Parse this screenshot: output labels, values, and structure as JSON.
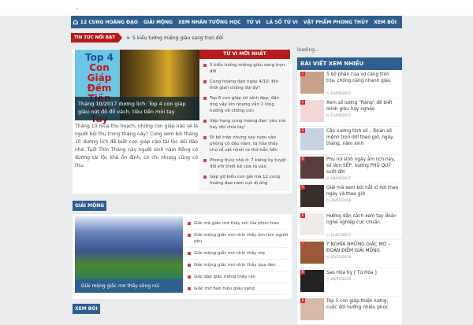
{
  "nav": {
    "items": [
      "12 CUNG HOÀNG ĐẠO",
      "GIẢI MỘNG",
      "XEM NHÂN TƯỚNG HỌC",
      "TỬ VI",
      "LÁ SỐ TỬ VI",
      "VẬT PHẨM PHONG THỦY",
      "XEM BÓI"
    ]
  },
  "ticker": {
    "label": "TIN TỨC NỔI BẬT",
    "text": "5 kiểu tướng miệng giàu sang trọn đời"
  },
  "featured": {
    "image_title": [
      "Top 4",
      "Con Giáp",
      "Đếm Tiền",
      "Mỏi Tay"
    ],
    "caption": "Tháng 10/2017 dương lịch: Top 4 con giáp giàu nứt đố đổ vách, tiêu tiền mỏi tay",
    "excerpt": "Tháng 10 mùa thu hoạch, những con giáp nào sẽ là người bội thu trong tháng này? Cùng xem bói tháng 10 dương lịch để biết con giáp nào tài lộc dồi dào nhé. Tuổi Thìn Tháng này người sinh năm Rồng có đường tài lộc khá ổn định, có chi nhưng cũng có thu,"
  },
  "latest": {
    "title": "TỬ VI MỚI NHẤT",
    "items": [
      "5 kiểu tướng miệng giàu sang trọn đời",
      "Cung hoàng đạo ngày 4/10: Khi thời gian chẳng đợi ấy!",
      "Top 6 con giáp nữ xinh đẹp, đàn ông vây kín nhưng vẫn 1 lòng hướng về chồng con",
      "Xếp hạng cung hoàng đạo 'yêu mà hay đòi chia tay'",
      "Đi bê tráp nhưng say rượu vào phòng cô dâu nằm, tá hỏa thấy chú rể vật mình ra thở hổn hển",
      "Phong thủy nhà ở: 7 kiêng kỵ tuyệt đối khi thiết kế cửa ra vào",
      "Gặp gỡ kiểu con gái mà 12 cung hoàng đạo nam cực dị ứng"
    ]
  },
  "giai_mong": {
    "title": "GIẢI MỘNG",
    "caption": "Giải mộng giấc mơ thấy sông núi",
    "items": [
      "Giải mã giấc mơ thấy núi lửa phun trào",
      "Giải mộng giấc mơ nhìn thấy ôm hôn người yêu",
      "Giải mộng giấc mơ nhìn thấy mẹ",
      "Giải mộng giấc mơ nhìn thấy quạ đen",
      "Giải đáp giấc mộng thấy rắn",
      "Giấc mơ báo hiệu giàu sang"
    ]
  },
  "xem_boi": {
    "title": "XEM BÓI"
  },
  "sidebar": {
    "loading": "loading...",
    "title": "BÀI VIẾT XEM NHIỀU",
    "items": [
      {
        "rank": "1",
        "title": "5 bộ phận của vợ căng tròn trịa, chồng càng nhanh giàu",
        "date": "16/09/2017",
        "color": "#c9a08a"
      },
      {
        "rank": "2",
        "title": "Xem số lượng \"Răng\" để biết mình giàu hay nghèo",
        "date": "15/09/2017",
        "color": "#f3d6d6"
      },
      {
        "rank": "3",
        "title": "Cân xương tính số – Đoán số mệnh trọn đời theo giờ, ngày, tháng, năm sinh",
        "date": "14/09/2017",
        "color": "#c7d3e3"
      },
      {
        "rank": "4",
        "title": "Phụ nữ sinh ngày âm lịch này, số làm SẾP, hưởng PHÚ QUÝ suốt đời",
        "date": "18/09/2017",
        "color": "#5a3c3c"
      },
      {
        "rank": "5",
        "title": "Giải mã xem bói hắt xì hơi theo ngày và theo giờ",
        "date": "26/01/2016",
        "color": "#3a2e2a"
      },
      {
        "rank": "6",
        "title": "Hướng dẫn cách xem tay đoán nghề nghiệp cực chuẩn",
        "date": "11/07/2017",
        "color": "#f0ebe6"
      },
      {
        "rank": "7",
        "title": "Ý NGHĨA NHỮNG GIẤC MƠ – ĐOÁN ĐIỀM GIẢI MỘNG",
        "date": "02/12/2014",
        "color": "#9a5a3a"
      },
      {
        "rank": "8",
        "title": "Sao Hỏa Kỵ [ Tử Hỏa ]",
        "date": "28/05/2015",
        "color": "#222"
      },
      {
        "rank": "9",
        "title": "Top 5 con giáp thiện lương, cuộc đời hưởng nhiều phúc",
        "date": "",
        "color": "#d8b8a8"
      }
    ]
  }
}
